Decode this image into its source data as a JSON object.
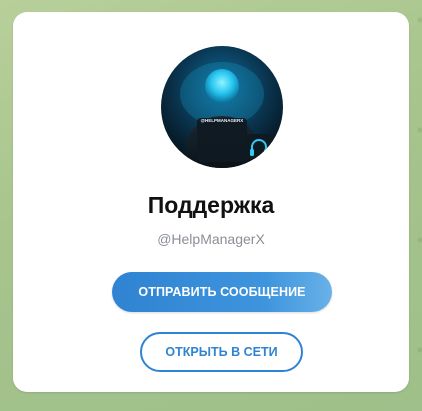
{
  "profile": {
    "name": "Поддержка",
    "username": "@HelpManagerX",
    "avatar_caption": "@HELPMANAGERX",
    "avatar_icon": "headset-icon"
  },
  "actions": {
    "send_message_label": "ОТПРАВИТЬ СООБЩЕНИЕ",
    "open_web_label": "ОТКРЫТЬ В СЕТИ"
  },
  "colors": {
    "accent": "#2f83d2",
    "background": "#a6c48c",
    "card": "#ffffff"
  }
}
